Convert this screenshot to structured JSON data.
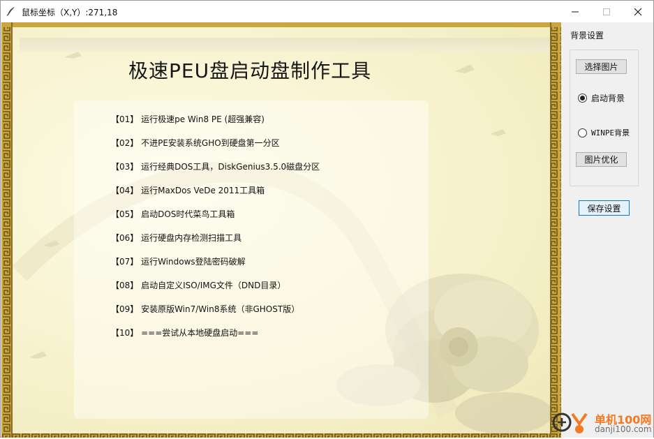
{
  "window": {
    "title": "鼠标坐标（X,Y）:271,18"
  },
  "preview": {
    "title": "极速PEU盘启动盘制作工具",
    "menu": [
      "【01】 运行极速pe Win8 PE (超强兼容)",
      "【02】 不进PE安装系统GHO到硬盘第一分区",
      "【03】 运行经典DOS工具，DiskGenius3.5.0磁盘分区",
      "【04】 运行MaxDos VeDe 2011工具箱",
      "【05】 启动DOS时代菜鸟工具箱",
      "【06】 运行硬盘内存检测扫描工具",
      "【07】 运行Windows登陆密码破解",
      "【08】 启动自定义ISO/IMG文件（DND目录）",
      "【09】 安装原版Win7/Win8系统（非GHOST版）",
      "【10】 ===尝试从本地硬盘启动==="
    ]
  },
  "settings": {
    "group_title": "背景设置",
    "select_image": "选择图片",
    "radio_boot": "启动背景",
    "radio_boot_selected": true,
    "radio_winpe": "WINPE背景",
    "optimize": "图片优化",
    "save": "保存设置"
  },
  "watermark": {
    "brand": "单机100网",
    "url": "danji100.com"
  },
  "colors": {
    "border_gold": "#b8952f",
    "border_dark": "#6b5418",
    "accent_orange": "#f47920",
    "save_border": "#0078d7"
  }
}
